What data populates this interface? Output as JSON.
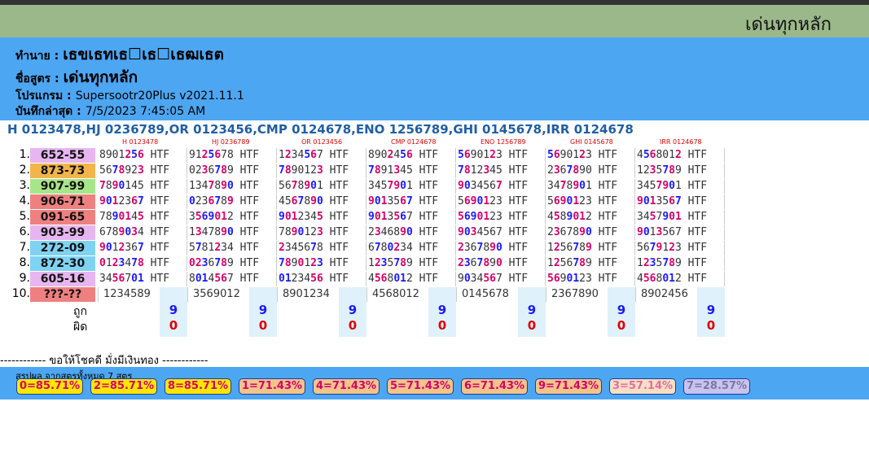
{
  "title": "เด่นทุกหลัก",
  "info": {
    "owner_label": "ทำนาย :",
    "owner_value": "เธขเธทเธ☐เธ☐เธฒเธต",
    "formula_label": "ชื่อสูตร :",
    "formula_value": "เด่นทุกหลัก",
    "program_label": "โปรแกรม :",
    "program_value": "Supersootr20Plus v2021.11.1",
    "updated_label": "บันทึกล่าสุด :",
    "updated_value": "7/5/2023 7:45:05 AM"
  },
  "formula_line": "H 0123478,HJ 0236789,OR 0123456,CMP 0124678,ENO 1256789,GHI 0145678,IRR 0124678",
  "columns": [
    "H 0123478",
    "HJ 0236789",
    "OR 0123456",
    "CMP 0124678",
    "ENO 1256789",
    "GHI 0145678",
    "IRR 0124678"
  ],
  "rows": [
    {
      "num": "1.",
      "pair": "652-55",
      "color": "#e7b6f0",
      "cells": [
        "8901256 HTF",
        "9125678 HTF",
        "1234567 HTF",
        "8902456 HTF",
        "5690123 HTF",
        "5690123 HTF",
        "4568012 HTF"
      ]
    },
    {
      "num": "2.",
      "pair": "873-73",
      "color": "#f2b54b",
      "cells": [
        "5678923 HTF",
        "0236789 HTF",
        "7890123 HTF",
        "7891345 HTF",
        "7812345 HTF",
        "2367890 HTF",
        "1235789 HTF"
      ]
    },
    {
      "num": "3.",
      "pair": "907-99",
      "color": "#a7e58a",
      "cells": [
        "7890145 HTF",
        "1347890 HTF",
        "5678901 HTF",
        "3457901 HTF",
        "9034567 HTF",
        "3478901 HTF",
        "3457901 HTF"
      ]
    },
    {
      "num": "4.",
      "pair": "906-71",
      "color": "#ef8080",
      "cells": [
        "9012367 HTF",
        "0236789 HTF",
        "4567890 HTF",
        "9013567 HTF",
        "5690123 HTF",
        "5690123 HTF",
        "9013567 HTF"
      ]
    },
    {
      "num": "5.",
      "pair": "091-65",
      "color": "#ef8080",
      "cells": [
        "7890145 HTF",
        "3569012 HTF",
        "9012345 HTF",
        "9013567 HTF",
        "5690123 HTF",
        "4589012 HTF",
        "3457901 HTF"
      ]
    },
    {
      "num": "6.",
      "pair": "903-99",
      "color": "#e7b6f0",
      "cells": [
        "6789034 HTF",
        "1347890 HTF",
        "7890123 HTF",
        "2346890 HTF",
        "9034567 HTF",
        "2367890 HTF",
        "9013567 HTF"
      ]
    },
    {
      "num": "7.",
      "pair": "272-09",
      "color": "#7fd3f2",
      "cells": [
        "9012367 HTF",
        "5781234 HTF",
        "2345678 HTF",
        "6780234 HTF",
        "2367890 HTF",
        "1256789 HTF",
        "5679123 HTF"
      ]
    },
    {
      "num": "8.",
      "pair": "872-30",
      "color": "#7fd3f2",
      "cells": [
        "0123478 HTF",
        "0236789 HTF",
        "7890123 HTF",
        "1235789 HTF",
        "2367890 HTF",
        "1256789 HTF",
        "1235789 HTF"
      ]
    },
    {
      "num": "9.",
      "pair": "605-16",
      "color": "#e7b6f0",
      "cells": [
        "3456701 HTF",
        "8014567 HTF",
        "0123456 HTF",
        "4568012 HTF",
        "9034567 HTF",
        "5690123 HTF",
        "4568012 HTF"
      ]
    },
    {
      "num": "10.",
      "pair": "???-??",
      "color": "#ef8080",
      "cells": [
        "1234589",
        "3569012",
        "8901234",
        "4568012",
        "0145678",
        "2367890",
        "8902456"
      ]
    }
  ],
  "right_label": "ถูก",
  "wrong_label": "ผิด",
  "right_counts": [
    "9",
    "9",
    "9",
    "9",
    "9",
    "9",
    "9"
  ],
  "wrong_counts": [
    "0",
    "0",
    "0",
    "0",
    "0",
    "0",
    "0"
  ],
  "luck_text": "------------ ขอให้โชคดี มั่งมีเงินทอง ------------",
  "summary_caption": "สรุปผล จากสูตรทั้งหมด 7 สูตร",
  "summary": [
    {
      "text": "0=85.71%",
      "bg": "#ffe600",
      "color": "#d6006a"
    },
    {
      "text": "2=85.71%",
      "bg": "#ffe600",
      "color": "#d6006a"
    },
    {
      "text": "8=85.71%",
      "bg": "#ffe600",
      "color": "#d6006a"
    },
    {
      "text": "1=71.43%",
      "bg": "#f2c48a",
      "color": "#d6006a"
    },
    {
      "text": "4=71.43%",
      "bg": "#f2c48a",
      "color": "#d6006a"
    },
    {
      "text": "5=71.43%",
      "bg": "#f2c48a",
      "color": "#d6006a"
    },
    {
      "text": "6=71.43%",
      "bg": "#f2c48a",
      "color": "#d6006a"
    },
    {
      "text": "9=71.43%",
      "bg": "#f2c48a",
      "color": "#d6006a"
    },
    {
      "text": "3=57.14%",
      "bg": "#f7dfc4",
      "color": "#e06fa0"
    },
    {
      "text": "7=28.57%",
      "bg": "#c9c3f0",
      "color": "#7a7aa0"
    }
  ]
}
